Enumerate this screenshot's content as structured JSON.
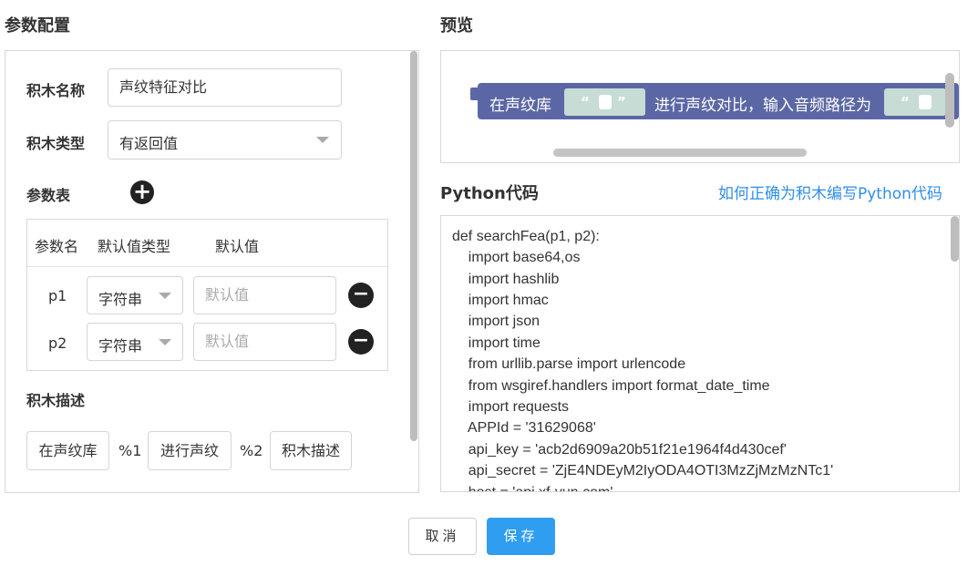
{
  "left": {
    "title": "参数配置",
    "name_label": "积木名称",
    "name_value": "声纹特征对比",
    "type_label": "积木类型",
    "type_value": "有返回值",
    "param_table_label": "参数表",
    "table_headers": [
      "参数名",
      "默认值类型",
      "默认值"
    ],
    "params": [
      {
        "name": "p1",
        "type": "字符串",
        "default_placeholder": "默认值"
      },
      {
        "name": "p2",
        "type": "字符串",
        "default_placeholder": "默认值"
      }
    ],
    "desc_label": "积木描述",
    "desc_parts": [
      "在声纹库",
      "%1",
      "进行声纹",
      "%2"
    ],
    "desc_placeholder": "积木描述"
  },
  "preview": {
    "title": "预览",
    "block_text_1": "在声纹库",
    "block_text_2": "进行声纹对比，输入音频路径为",
    "quote_open": "“",
    "quote_close": "”"
  },
  "code": {
    "title": "Python代码",
    "help_link": "如何正确为积木编写Python代码",
    "lines": [
      "def searchFea(p1, p2):",
      "    import base64,os",
      "    import hashlib",
      "    import hmac",
      "    import json",
      "    import time",
      "    from urllib.parse import urlencode",
      "    from wsgiref.handlers import format_date_time",
      "    import requests",
      "    APPId = '31629068'",
      "    api_key = 'acb2d6909a20b51f21e1964f4d430cef'",
      "    api_secret = 'ZjE4NDEyM2IyODA4OTI3MzZjMzMzNTc1'",
      "    host = 'api.xf-yun.com'"
    ]
  },
  "footer": {
    "cancel_label": "取消",
    "save_label": "保存"
  }
}
